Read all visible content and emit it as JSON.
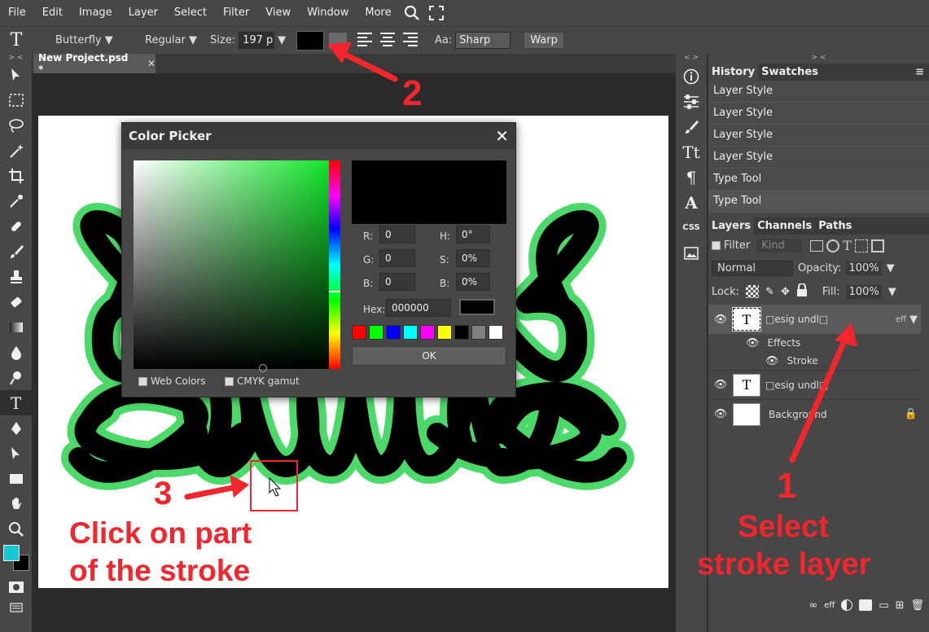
{
  "menu": {
    "items": [
      "File",
      "Edit",
      "Image",
      "Layer",
      "Select",
      "Filter",
      "View",
      "Window",
      "More"
    ]
  },
  "options": {
    "font": "Butterfly ▼",
    "style": "Regular ▼",
    "size_label": "Size:",
    "size_value": "197 px",
    "size_arrow": "▼",
    "aa_label": "Aa:",
    "aa_value": "Sharp",
    "warp": "Warp",
    "text_color": "#000000"
  },
  "tabs": {
    "doc": "New Project.psd *",
    "close": "✕"
  },
  "dialog": {
    "title": "Color Picker",
    "close": "✕",
    "r_label": "R:",
    "r": "0",
    "g_label": "G:",
    "g": "0",
    "b_label": "B:",
    "b": "0",
    "h_label": "H:",
    "h": "0°",
    "s_label": "S:",
    "s": "0%",
    "v_label": "B:",
    "v": "0%",
    "hex_label": "Hex:",
    "hex": "000000",
    "ok": "OK",
    "web_colors": "Web Colors",
    "cmyk": "CMYK gamut",
    "presets": [
      "#ff0000",
      "#00ff00",
      "#0000ff",
      "#00ffff",
      "#ff00ff",
      "#ffff00",
      "#000000",
      "#808080",
      "#ffffff"
    ]
  },
  "history": {
    "tab1": "History",
    "tab2": "Swatches",
    "items": [
      "Layer Style",
      "Layer Style",
      "Layer Style",
      "Layer Style",
      "Type Tool",
      "Type Tool"
    ]
  },
  "layers": {
    "tab1": "Layers",
    "tab2": "Channels",
    "tab3": "Paths",
    "filter": "Filter",
    "kind": "Kind",
    "blend": "Normal",
    "opacity_label": "Opacity:",
    "opacity": "100%",
    "lock_label": "Lock:",
    "fill_label": "Fill:",
    "fill": "100%",
    "layer1": "□esig   undl□",
    "layer1_fx": "eff",
    "effects": "Effects",
    "stroke": "Stroke",
    "layer2": "□esig   undl□",
    "background": "Background",
    "bottom_fx": "eff"
  },
  "annotations": {
    "n1": "1",
    "n2": "2",
    "n3": "3",
    "select1": "Select",
    "select2": "stroke layer",
    "click1": "Click on part",
    "click2": "of the stroke"
  },
  "colors": {
    "fg": "#16c7d8",
    "bg": "#000000",
    "stroke_green": "#4bd96a",
    "accent_red": "#f2262c"
  }
}
